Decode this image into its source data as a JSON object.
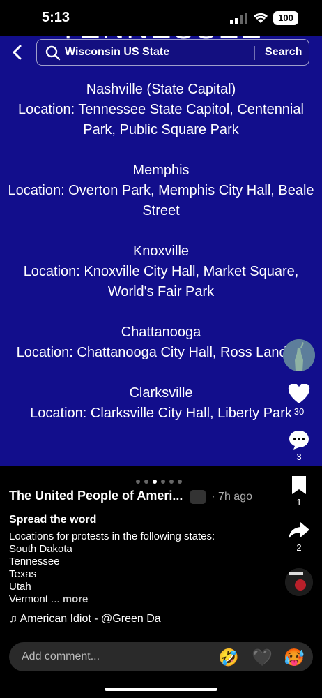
{
  "status": {
    "time": "5:13",
    "battery": "100"
  },
  "slide": {
    "ghost_title": "TENNESSEE",
    "cities": [
      {
        "name": "Nashville (State Capital)",
        "location": "Location: Tennessee State Capitol, Centennial Park, Public Square Park"
      },
      {
        "name": "Memphis",
        "location": "Location: Overton Park, Memphis City Hall, Beale Street"
      },
      {
        "name": "Knoxville",
        "location": "Location: Knoxville City Hall, Market Square, World's Fair Park"
      },
      {
        "name": "Chattanooga",
        "location": "Location: Chattanooga City Hall, Ross Landing"
      },
      {
        "name": "Clarksville",
        "location": "Location: Clarksville City Hall, Liberty Park"
      }
    ]
  },
  "search": {
    "query": "Wisconsin US State",
    "button": "Search"
  },
  "post": {
    "username": "The United People of Ameri...",
    "age": "· 7h ago",
    "caption_title": "Spread the word",
    "caption": "Locations for protests in the following states:\nSouth Dakota\nTennessee\nTexas\nUtah\nVermont ...",
    "more": "more",
    "music": "♫ American Idiot - @Green Da"
  },
  "actions": {
    "likes": "30",
    "comments": "3",
    "saves": "1",
    "shares": "2"
  },
  "comment": {
    "placeholder": "Add comment...",
    "emojis": [
      "🤣",
      "🖤",
      "🥵"
    ]
  },
  "colors": {
    "slide_bg": "#120e8c"
  }
}
